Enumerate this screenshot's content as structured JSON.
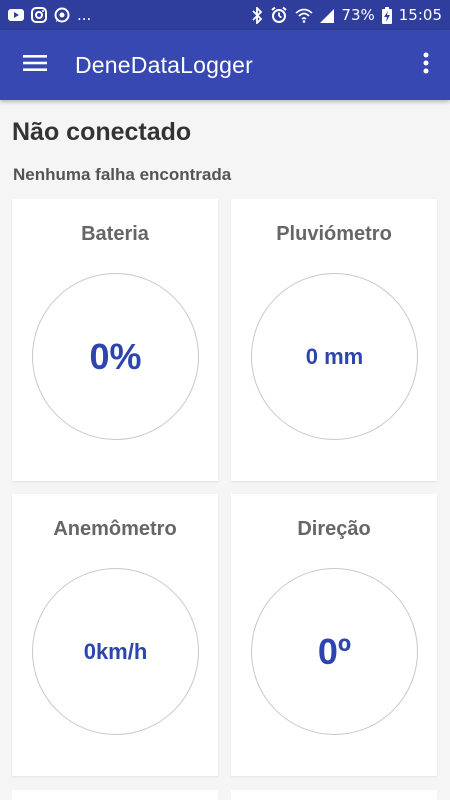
{
  "status_bar": {
    "notifications_more": "...",
    "battery_percent": "73%",
    "time": "15:05"
  },
  "app_bar": {
    "title": "DeneDataLogger"
  },
  "connection": {
    "status": "Não conectado",
    "fault": "Nenhuma falha encontrada"
  },
  "cards": {
    "battery": {
      "title": "Bateria",
      "value": "0%"
    },
    "rain": {
      "title": "Pluviómetro",
      "value": "0 mm"
    },
    "wind_speed": {
      "title": "Anemômetro",
      "value": "0km/h"
    },
    "direction": {
      "title": "Direção",
      "value": "0º"
    }
  },
  "colors": {
    "primary": "#3748b3",
    "primary_dark": "#2f3d9c",
    "value_text": "#2e45ad"
  }
}
